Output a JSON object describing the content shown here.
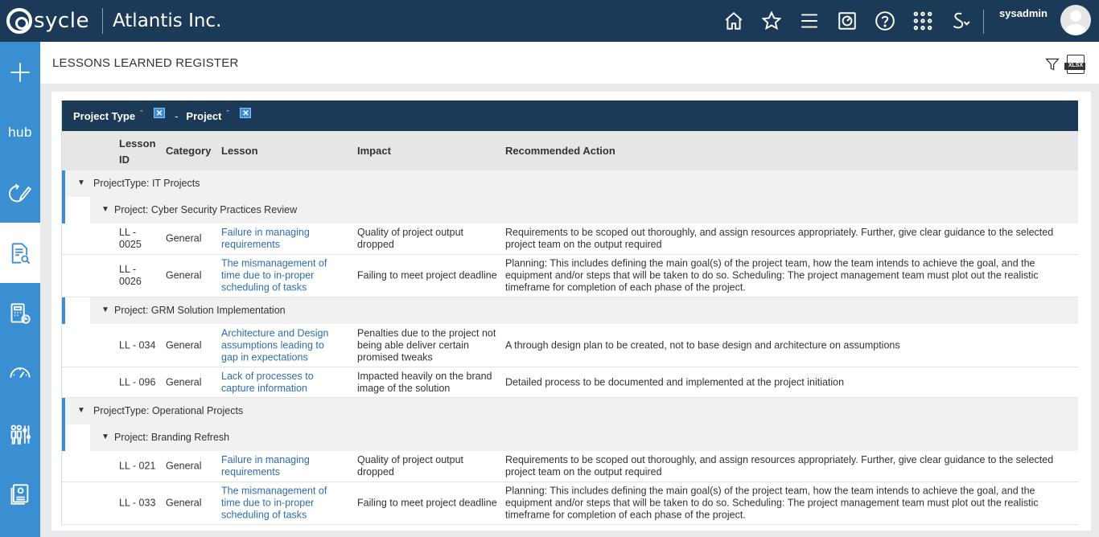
{
  "header": {
    "logo_text": "sycle",
    "company": "Atlantis Inc.",
    "username": "sysadmin",
    "icons": [
      "home-icon",
      "star-icon",
      "menu-icon",
      "dashboard-icon",
      "help-icon",
      "apps-grid-icon",
      "s-dropdown-icon"
    ]
  },
  "sidebar": {
    "items": [
      {
        "name": "add-icon"
      },
      {
        "name": "hub-icon",
        "label": "hub"
      },
      {
        "name": "refresh-edit-icon"
      },
      {
        "name": "document-search-icon",
        "active": true
      },
      {
        "name": "calculator-clock-icon"
      },
      {
        "name": "gauge-icon"
      },
      {
        "name": "people-sliders-icon"
      },
      {
        "name": "report-icon"
      }
    ]
  },
  "page": {
    "title": "LESSONS LEARNED REGISTER",
    "actions": [
      "filter-icon",
      "xlsx-export-icon"
    ],
    "xlsx_label": "XLSX"
  },
  "grouping": {
    "chips": [
      {
        "label": "Project Type",
        "sort": "ˆ",
        "remove": "✕"
      },
      {
        "label": "Project",
        "sort": "ˆ",
        "remove": "✕"
      }
    ],
    "separator": "-"
  },
  "columns": {
    "lesson_id_1": "Lesson",
    "lesson_id_2": "ID",
    "category": "Category",
    "lesson": "Lesson",
    "impact": "Impact",
    "action": "Recommended Action"
  },
  "groups": [
    {
      "label": "ProjectType: IT Projects",
      "projects": [
        {
          "label": "Project: Cyber Security Practices Review",
          "rows": [
            {
              "id": "LL - 0025",
              "category": "General",
              "lesson": "Failure in managing requirements",
              "impact": "Quality of project output dropped",
              "action": "Requirements to be scoped out thoroughly, and assign resources appropriately. Further, give clear guidance to the selected project team on the output required"
            },
            {
              "id": "LL - 0026",
              "category": "General",
              "lesson": "The mismanagement of time due to in-proper scheduling of tasks",
              "impact": "Failing to meet project deadline",
              "action": "Planning: This includes defining the main goal(s) of the project team, how the team intends to achieve the goal, and the equipment and/or steps that will be taken to do so. Scheduling: The project management team must plot out the realistic timeframe for completion of each phase of the project."
            }
          ]
        },
        {
          "label": "Project: GRM Solution Implementation",
          "rows": [
            {
              "id": "LL - 034",
              "category": "General",
              "lesson": "Architecture and Design assumptions leading to gap in expectations",
              "impact": "Penalties due to the project not being able deliver certain promised tweaks",
              "action": "A through design plan to be created, not to base design and architecture on assumptions"
            },
            {
              "id": "LL - 096",
              "category": "General",
              "lesson": "Lack of processes to capture information",
              "impact": "Impacted heavily on the brand image of the solution",
              "action": "Detailed process to be documented and implemented at the project initiation"
            }
          ]
        }
      ]
    },
    {
      "label": "ProjectType: Operational Projects",
      "projects": [
        {
          "label": "Project: Branding Refresh",
          "rows": [
            {
              "id": "LL - 021",
              "category": "General",
              "lesson": "Failure in managing requirements",
              "impact": "Quality of project output dropped",
              "action": "Requirements to be scoped out thoroughly, and assign resources appropriately. Further, give clear guidance to the selected project team on the output required"
            },
            {
              "id": "LL - 033",
              "category": "General",
              "lesson": "The mismanagement of time due to in-proper scheduling of tasks",
              "impact": "Failing to meet project deadline",
              "action": "Planning: This includes defining the main goal(s) of the project team, how the team intends to achieve the goal, and the equipment and/or steps that will be taken to do so. Scheduling: The project management team must plot out the realistic timeframe for completion of each phase of the project."
            }
          ]
        }
      ]
    }
  ]
}
